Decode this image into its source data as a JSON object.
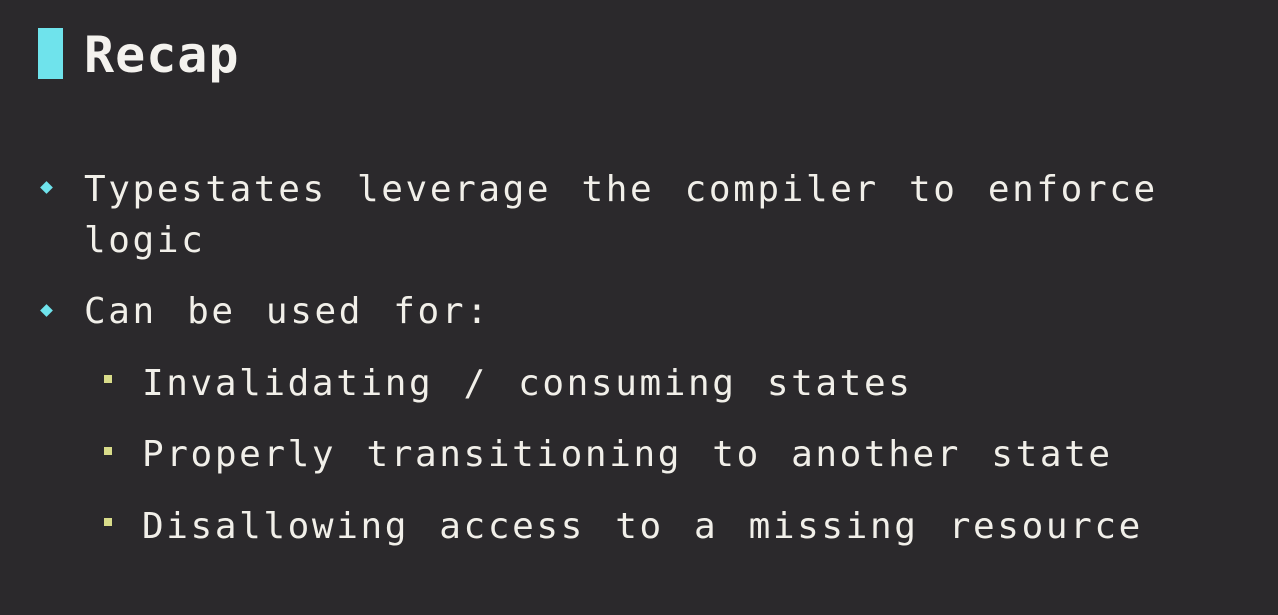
{
  "slide": {
    "title": "Recap",
    "accent_color": "#6fe3ec",
    "sub_marker_color": "#d9dc8a",
    "background": "#2b292c",
    "bullets": [
      {
        "line1": "Typestates leverage the compiler to enforce",
        "line2": "logic"
      },
      {
        "line1": "Can be used for:"
      }
    ],
    "sub_bullets": [
      "Invalidating / consuming states",
      "Properly transitioning to another state",
      "Disallowing access to a missing resource"
    ]
  }
}
